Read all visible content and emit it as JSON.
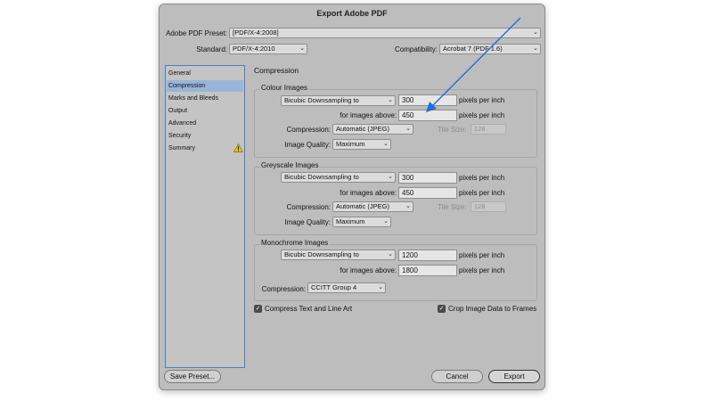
{
  "window": {
    "title": "Export Adobe PDF"
  },
  "header": {
    "preset_label": "Adobe PDF Preset:",
    "preset_value": "[PDF/X-4:2008]",
    "standard_label": "Standard:",
    "standard_value": "PDF/X-4:2010",
    "compat_label": "Compatibility:",
    "compat_value": "Acrobat 7 (PDF 1.6)"
  },
  "sidebar": {
    "items": [
      {
        "label": "General"
      },
      {
        "label": "Compression"
      },
      {
        "label": "Marks and Bleeds"
      },
      {
        "label": "Output"
      },
      {
        "label": "Advanced"
      },
      {
        "label": "Security"
      },
      {
        "label": "Summary"
      }
    ],
    "selected": "Compression",
    "warning_icon": "warning-triangle-icon"
  },
  "main": {
    "section_title": "Compression",
    "colour": {
      "title": "Colour Images",
      "downsample": "Bicubic Downsampling to",
      "ppi": "300",
      "ppi_unit": "pixels per inch",
      "above_label": "for images above:",
      "above_value": "450",
      "above_unit": "pixels per inch",
      "compression_label": "Compression:",
      "compression_value": "Automatic (JPEG)",
      "tile_label": "Tile Size:",
      "tile_value": "128",
      "quality_label": "Image Quality:",
      "quality_value": "Maximum"
    },
    "grey": {
      "title": "Greyscale Images",
      "downsample": "Bicubic Downsampling to",
      "ppi": "300",
      "ppi_unit": "pixels per inch",
      "above_label": "for images above:",
      "above_value": "450",
      "above_unit": "pixels per inch",
      "compression_label": "Compression:",
      "compression_value": "Automatic (JPEG)",
      "tile_label": "Tile Size:",
      "tile_value": "128",
      "quality_label": "Image Quality:",
      "quality_value": "Maximum"
    },
    "mono": {
      "title": "Monochrome Images",
      "downsample": "Bicubic Downsampling to",
      "ppi": "1200",
      "ppi_unit": "pixels per inch",
      "above_label": "for images above:",
      "above_value": "1800",
      "above_unit": "pixels per inch",
      "compression_label": "Compression:",
      "compression_value": "CCITT Group 4"
    },
    "compress_text": {
      "label": "Compress Text and Line Art",
      "checked": true
    },
    "crop_data": {
      "label": "Crop Image Data to Frames",
      "checked": true
    }
  },
  "footer": {
    "save_preset": "Save Preset...",
    "cancel": "Cancel",
    "export": "Export"
  },
  "annotation": {
    "color": "#1f6fd6"
  }
}
